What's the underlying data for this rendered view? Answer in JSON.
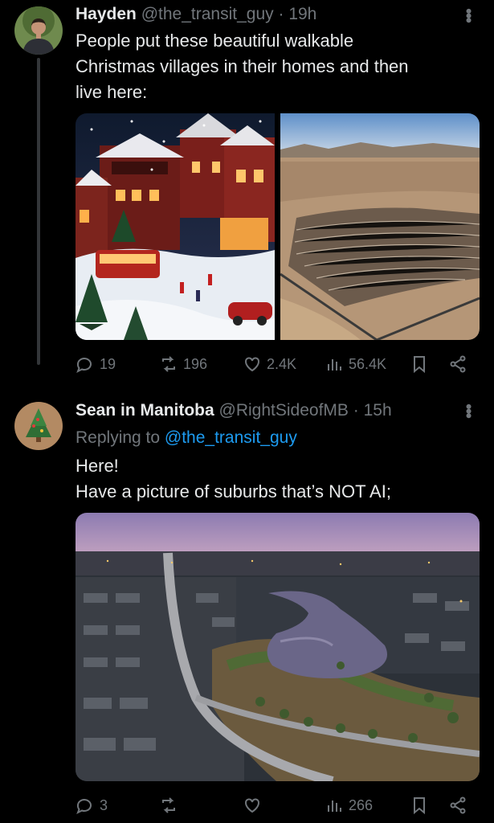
{
  "tweet1": {
    "display_name": "Hayden",
    "handle": "@the_transit_guy",
    "separator": "·",
    "time": "19h",
    "text_line1": "People put these beautiful walkable",
    "text_line2": "Christmas villages in their homes and then",
    "text_line3": "live here:",
    "replies": "19",
    "reposts": "196",
    "likes": "2.4K",
    "views": "56.4K"
  },
  "tweet2": {
    "display_name": "Sean in Manitoba",
    "handle": "@RightSideofMB",
    "separator": "·",
    "time": "15h",
    "replying_prefix": "Replying to ",
    "replying_to": "@the_transit_guy",
    "text_line1": "Here!",
    "text_line2": "Have a picture of suburbs that’s NOT AI;",
    "replies": "3",
    "reposts": "",
    "likes": "",
    "views": "266"
  },
  "colors": {
    "background": "#000000",
    "text": "#e7e9ea",
    "muted": "#71767b",
    "link": "#1d9bf0"
  },
  "icons": [
    "reply-icon",
    "repost-icon",
    "like-icon",
    "views-icon",
    "bookmark-icon",
    "share-icon",
    "more-icon"
  ]
}
